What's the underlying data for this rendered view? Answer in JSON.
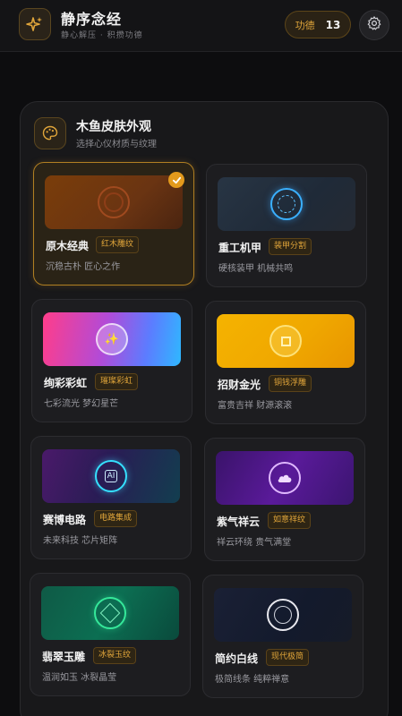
{
  "header": {
    "title": "静序念经",
    "subtitle": "静心解压 · 积攒功德",
    "merit_label": "功德",
    "merit_value": "13",
    "app_icon": "sparkle-icon",
    "settings_icon": "gear-icon"
  },
  "section": {
    "title": "木鱼皮肤外观",
    "subtitle": "选择心仪材质与纹理",
    "icon": "palette-icon"
  },
  "skins": [
    {
      "name": "原木经典",
      "tag": "红木雕纹",
      "desc": "沉稳古朴 匠心之作",
      "selected": true
    },
    {
      "name": "重工机甲",
      "tag": "装甲分割",
      "desc": "硬核装甲 机械共鸣",
      "selected": false
    },
    {
      "name": "绚彩彩虹",
      "tag": "璀璨彩虹",
      "desc": "七彩流光 梦幻星芒",
      "selected": false,
      "preview_icon": "✨"
    },
    {
      "name": "招财金光",
      "tag": "铜钱浮雕",
      "desc": "富贵吉祥 财源滚滚",
      "selected": false
    },
    {
      "name": "赛博电路",
      "tag": "电路集成",
      "desc": "未来科技 芯片矩阵",
      "selected": false,
      "preview_icon": "AI"
    },
    {
      "name": "紫气祥云",
      "tag": "如意祥纹",
      "desc": "祥云环绕 贵气满堂",
      "selected": false
    },
    {
      "name": "翡翠玉雕",
      "tag": "冰裂玉纹",
      "desc": "温润如玉 冰裂晶莹",
      "selected": false
    },
    {
      "name": "简约白线",
      "tag": "现代极简",
      "desc": "极简线条 纯粹禅意",
      "selected": false
    }
  ],
  "colors": {
    "accent": "#e39a1c",
    "background": "#0d0d0f"
  }
}
